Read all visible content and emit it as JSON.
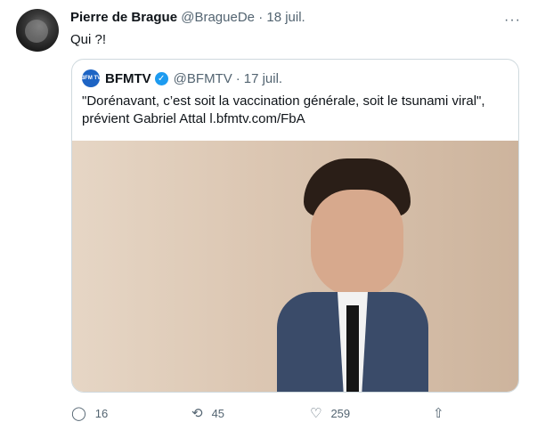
{
  "tweet": {
    "author_name": "Pierre de Brague",
    "author_handle": "@BragueDe",
    "dot": "·",
    "date": "18 juil.",
    "more": "···",
    "text": "Qui ?!"
  },
  "quote": {
    "logo_text": "BFM TV",
    "name": "BFMTV",
    "verified": "✓",
    "handle": "@BFMTV",
    "dot": "·",
    "date": "17 juil.",
    "text": "\"Dorénavant, c’est soit la vaccination générale, soit le tsunami viral\", prévient Gabriel Attal l.bfmtv.com/FbA"
  },
  "actions": {
    "reply_count": "16",
    "retweet_count": "45",
    "like_count": "259",
    "reply_icon": "◯",
    "retweet_icon": "⟲",
    "like_icon": "♡",
    "share_icon": "⇧"
  }
}
